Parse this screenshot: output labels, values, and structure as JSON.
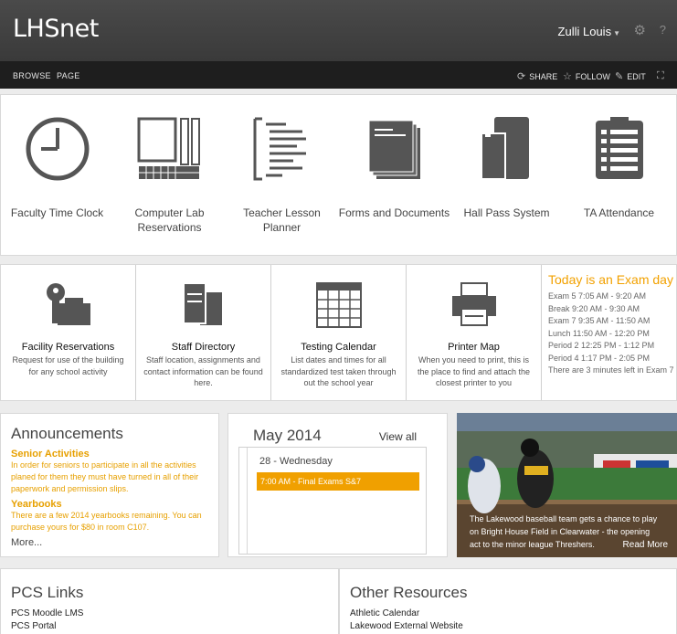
{
  "header": {
    "site_title": "LHSnet",
    "user_name": "Zulli Louis",
    "settings_icon": "gear-icon",
    "help_icon": "help-icon",
    "help_glyph": "?"
  },
  "ribbon": {
    "tabs": [
      "BROWSE",
      "PAGE"
    ],
    "actions": [
      {
        "label": "SHARE",
        "icon": "share-icon"
      },
      {
        "label": "FOLLOW",
        "icon": "star-icon"
      },
      {
        "label": "EDIT",
        "icon": "pencil-icon"
      }
    ],
    "focus_icon": "fullscreen-icon"
  },
  "tiles": [
    {
      "label": "Faculty Time Clock",
      "icon": "clock-icon"
    },
    {
      "label": "Computer Lab Reservations",
      "icon": "computer-lab-icon"
    },
    {
      "label": "Teacher Lesson Planner",
      "icon": "lesson-planner-icon"
    },
    {
      "label": "Forms and Documents",
      "icon": "documents-icon"
    },
    {
      "label": "Hall Pass System",
      "icon": "hall-pass-icon"
    },
    {
      "label": "TA Attendance",
      "icon": "attendance-icon"
    }
  ],
  "features": [
    {
      "title": "Facility Reservations",
      "desc": "Request for use of the building for any school activity",
      "icon": "key-building-icon"
    },
    {
      "title": "Staff Directory",
      "desc": "Staff location, assignments and contact information can be found here.",
      "icon": "directory-icon"
    },
    {
      "title": "Testing Calendar",
      "desc": "List dates and times for all standardized test taken through out the school year",
      "icon": "calendar-grid-icon"
    },
    {
      "title": "Printer Map",
      "desc": "When you need to print, this is the place to find and attach the closest printer to you",
      "icon": "printer-icon"
    }
  ],
  "exam": {
    "heading": "Today is an Exam day",
    "lines": [
      "Exam 5 7:05 AM - 9:20 AM",
      "Break 9:20 AM - 9:30 AM",
      "Exam 7 9:35 AM - 11:50 AM",
      "Lunch 11:50 AM - 12:20 PM",
      "Period 2 12:25 PM - 1:12 PM",
      "Period 4 1:17 PM - 2:05 PM",
      "There are 3 minutes left in Exam 7"
    ]
  },
  "announcements": {
    "heading": "Announcements",
    "items": [
      {
        "title": "Senior Activities",
        "text": "In order for seniors to participate in all the activities planed for them they must have turned in all of their paperwork and permission slips."
      },
      {
        "title": "Yearbooks",
        "text": "There are a few 2014 yearbooks remaining. You can purchase yours for $80 in room C107."
      }
    ],
    "more": "More..."
  },
  "calendar": {
    "month": "May 2014",
    "view_all": "View all",
    "day": "28 - Wednesday",
    "event": "7:00 AM - Final Exams S&7"
  },
  "photo": {
    "caption": "The Lakewood baseball team gets a chance to play on Bright House Field in Clearwater - the opening act to the minor league Threshers.",
    "read_more": "Read More"
  },
  "pcs_links": {
    "heading": "PCS Links",
    "items": [
      "PCS Moodle LMS",
      "PCS Portal"
    ]
  },
  "other_resources": {
    "heading": "Other Resources",
    "items": [
      "Athletic Calendar",
      "Lakewood External Website"
    ]
  },
  "colors": {
    "accent": "#f2a100",
    "header_bg": "#444444",
    "ribbon_bg": "#1e1e1e",
    "icon_gray": "#555555"
  }
}
